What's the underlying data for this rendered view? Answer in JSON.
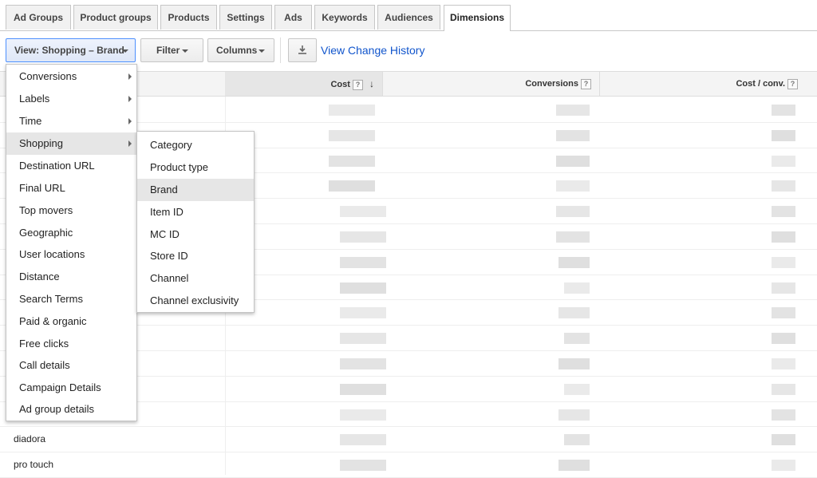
{
  "tabs": [
    "Ad Groups",
    "Product groups",
    "Products",
    "Settings",
    "Ads",
    "Keywords",
    "Audiences",
    "Dimensions"
  ],
  "toolbar": {
    "view_label": "View: Shopping – Brand",
    "filter_label": "Filter",
    "columns_label": "Columns",
    "download_icon": "download-icon",
    "change_history_label": "View Change History"
  },
  "table": {
    "columns": [
      {
        "label": "Cost",
        "help": "?",
        "sorted": "descending"
      },
      {
        "label": "Conversions",
        "help": "?"
      },
      {
        "label": "Cost / conv.",
        "help": "?"
      }
    ],
    "visible_rows": [
      "diadora",
      "pro touch"
    ]
  },
  "view_menu": {
    "items": [
      "Conversions",
      "Labels",
      "Time",
      "Shopping",
      "Destination URL",
      "Final URL",
      "Top movers",
      "Geographic",
      "User locations",
      "Distance",
      "Search Terms",
      "Paid & organic",
      "Free clicks",
      "Call details",
      "Campaign Details",
      "Ad group details"
    ],
    "highlighted": "Shopping"
  },
  "shopping_submenu": {
    "items": [
      "Category",
      "Product type",
      "Brand",
      "Item ID",
      "MC ID",
      "Store ID",
      "Channel",
      "Channel exclusivity"
    ],
    "highlighted": "Brand"
  },
  "colors": {
    "link": "#1155cc",
    "active_button_border": "#4d90fe",
    "highlight": "#e6e6e6"
  }
}
